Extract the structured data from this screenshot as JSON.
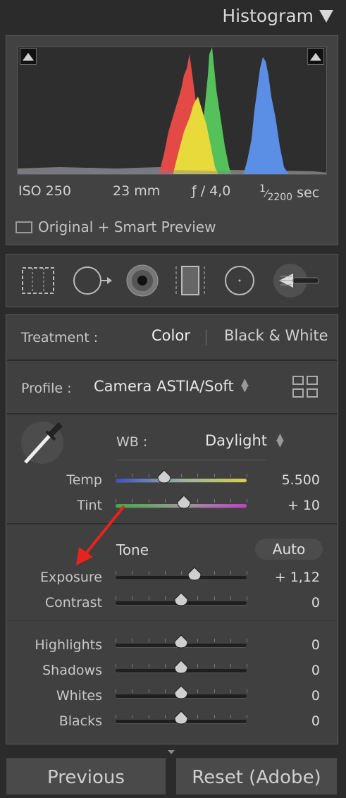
{
  "histogram": {
    "title": "Histogram",
    "iso": "ISO 250",
    "focal_length": "23 mm",
    "aperture": "ƒ / 4,0",
    "shutter_num": "1",
    "shutter_den": "2200",
    "shutter_unit": "sec",
    "preview_label": "Original + Smart Preview"
  },
  "basic": {
    "treatment_label": "Treatment :",
    "treatment_options": [
      "Color",
      "Black & White"
    ],
    "profile_label": "Profile :",
    "profile_value": "Camera ASTIA/Soft",
    "wb_label": "WB :",
    "wb_value": "Daylight",
    "temp_label": "Temp",
    "temp_value": "5.500",
    "tint_label": "Tint",
    "tint_value": "+ 10",
    "tone_label": "Tone",
    "auto_label": "Auto",
    "sliders": [
      {
        "label": "Exposure",
        "value": "+ 1,12",
        "pos": 0.6
      },
      {
        "label": "Contrast",
        "value": "0",
        "pos": 0.5
      },
      {
        "label": "Highlights",
        "value": "0",
        "pos": 0.5
      },
      {
        "label": "Shadows",
        "value": "0",
        "pos": 0.5
      },
      {
        "label": "Whites",
        "value": "0",
        "pos": 0.5
      },
      {
        "label": "Blacks",
        "value": "0",
        "pos": 0.5
      }
    ],
    "temp_pos": 0.37,
    "tint_pos": 0.52
  },
  "buttons": {
    "previous": "Previous",
    "reset": "Reset (Adobe)"
  },
  "colors": {
    "annotation_arrow": "#e8231c",
    "hist_red": "#e34a46",
    "hist_green": "#55c15a",
    "hist_blue": "#5b8fe6",
    "hist_yellow": "#e8da3a"
  }
}
